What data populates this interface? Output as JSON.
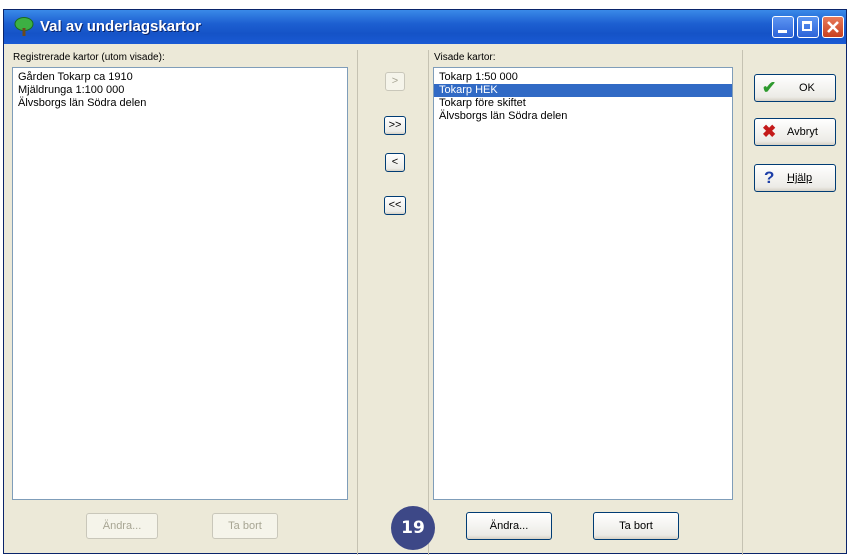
{
  "window": {
    "title": "Val av underlagskartor"
  },
  "left_panel": {
    "label": "Registrerade kartor (utom visade):",
    "items": [
      "Gården Tokarp ca 1910",
      "Mjäldrunga 1:100 000",
      "Älvsborgs län Södra delen"
    ],
    "edit_label": "Ändra...",
    "remove_label": "Ta bort"
  },
  "transfer": {
    "add_one": ">",
    "add_all": ">>",
    "remove_one": "<",
    "remove_all": "<<"
  },
  "right_panel": {
    "label": "Visade kartor:",
    "items": [
      "Tokarp 1:50 000",
      "Tokarp HEK",
      "Tokarp före skiftet",
      "Älvsborgs län Södra delen"
    ],
    "selected": "Tokarp HEK",
    "edit_label": "Ändra...",
    "remove_label": "Ta bort"
  },
  "actions": {
    "ok_label": "OK",
    "cancel_label": "Avbryt",
    "help_label": "Hjälp",
    "ok_icon": "checkmark-icon",
    "cancel_icon": "x-icon",
    "help_icon": "question-icon"
  },
  "badge": {
    "number": "19"
  },
  "colors": {
    "titlebar": "#1d5fd1",
    "selection": "#316ac5",
    "badge": "#3d4887",
    "ok_green": "#2e9a2e",
    "cancel_red": "#c41a1a",
    "help_blue": "#1d3fa8"
  }
}
